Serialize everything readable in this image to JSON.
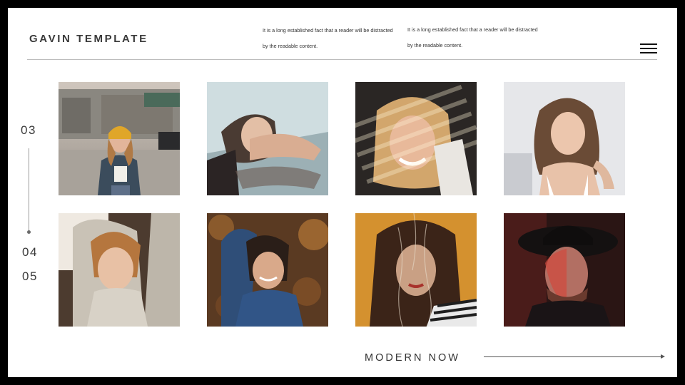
{
  "header": {
    "brand": "GAVIN TEMPLATE",
    "blurb_left": "It is a long established fact that a reader will be distracted by the readable content.",
    "blurb_right": "It is a long established fact that a reader will be distracted by the readable content.",
    "menu_icon": "hamburger-menu-icon"
  },
  "pagination": {
    "current": "03",
    "next": "04",
    "after": "05"
  },
  "gallery": {
    "photos": [
      {
        "subject": "woman-yellow-beanie-street"
      },
      {
        "subject": "woman-resting-on-arm-reflection"
      },
      {
        "subject": "woman-smiling-light-stripes"
      },
      {
        "subject": "woman-wavy-hair-white-background"
      },
      {
        "subject": "woman-sweater-arms-raised"
      },
      {
        "subject": "woman-blue-sweater-autumn"
      },
      {
        "subject": "woman-long-hair-glass-texture"
      },
      {
        "subject": "man-black-hat-red-light"
      }
    ]
  },
  "footer": {
    "title": "MODERN NOW",
    "arrow_icon": "right-arrow-icon"
  },
  "colors": {
    "frame": "#000000",
    "slide": "#ffffff",
    "text": "#333333"
  }
}
